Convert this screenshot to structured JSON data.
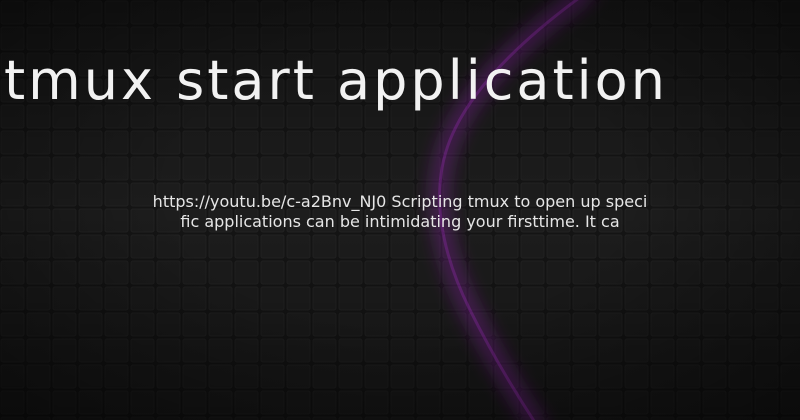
{
  "title": "tmux start application",
  "description": {
    "line1": "https://youtu.be/c-a2Bnv_NJ0 Scripting tmux to open up speci",
    "line2": "fic applications can be intimidating your firsttime.  It ca"
  },
  "colors": {
    "background": "#151515",
    "accent": "#b22fd6",
    "text": "#f2f2f2"
  }
}
